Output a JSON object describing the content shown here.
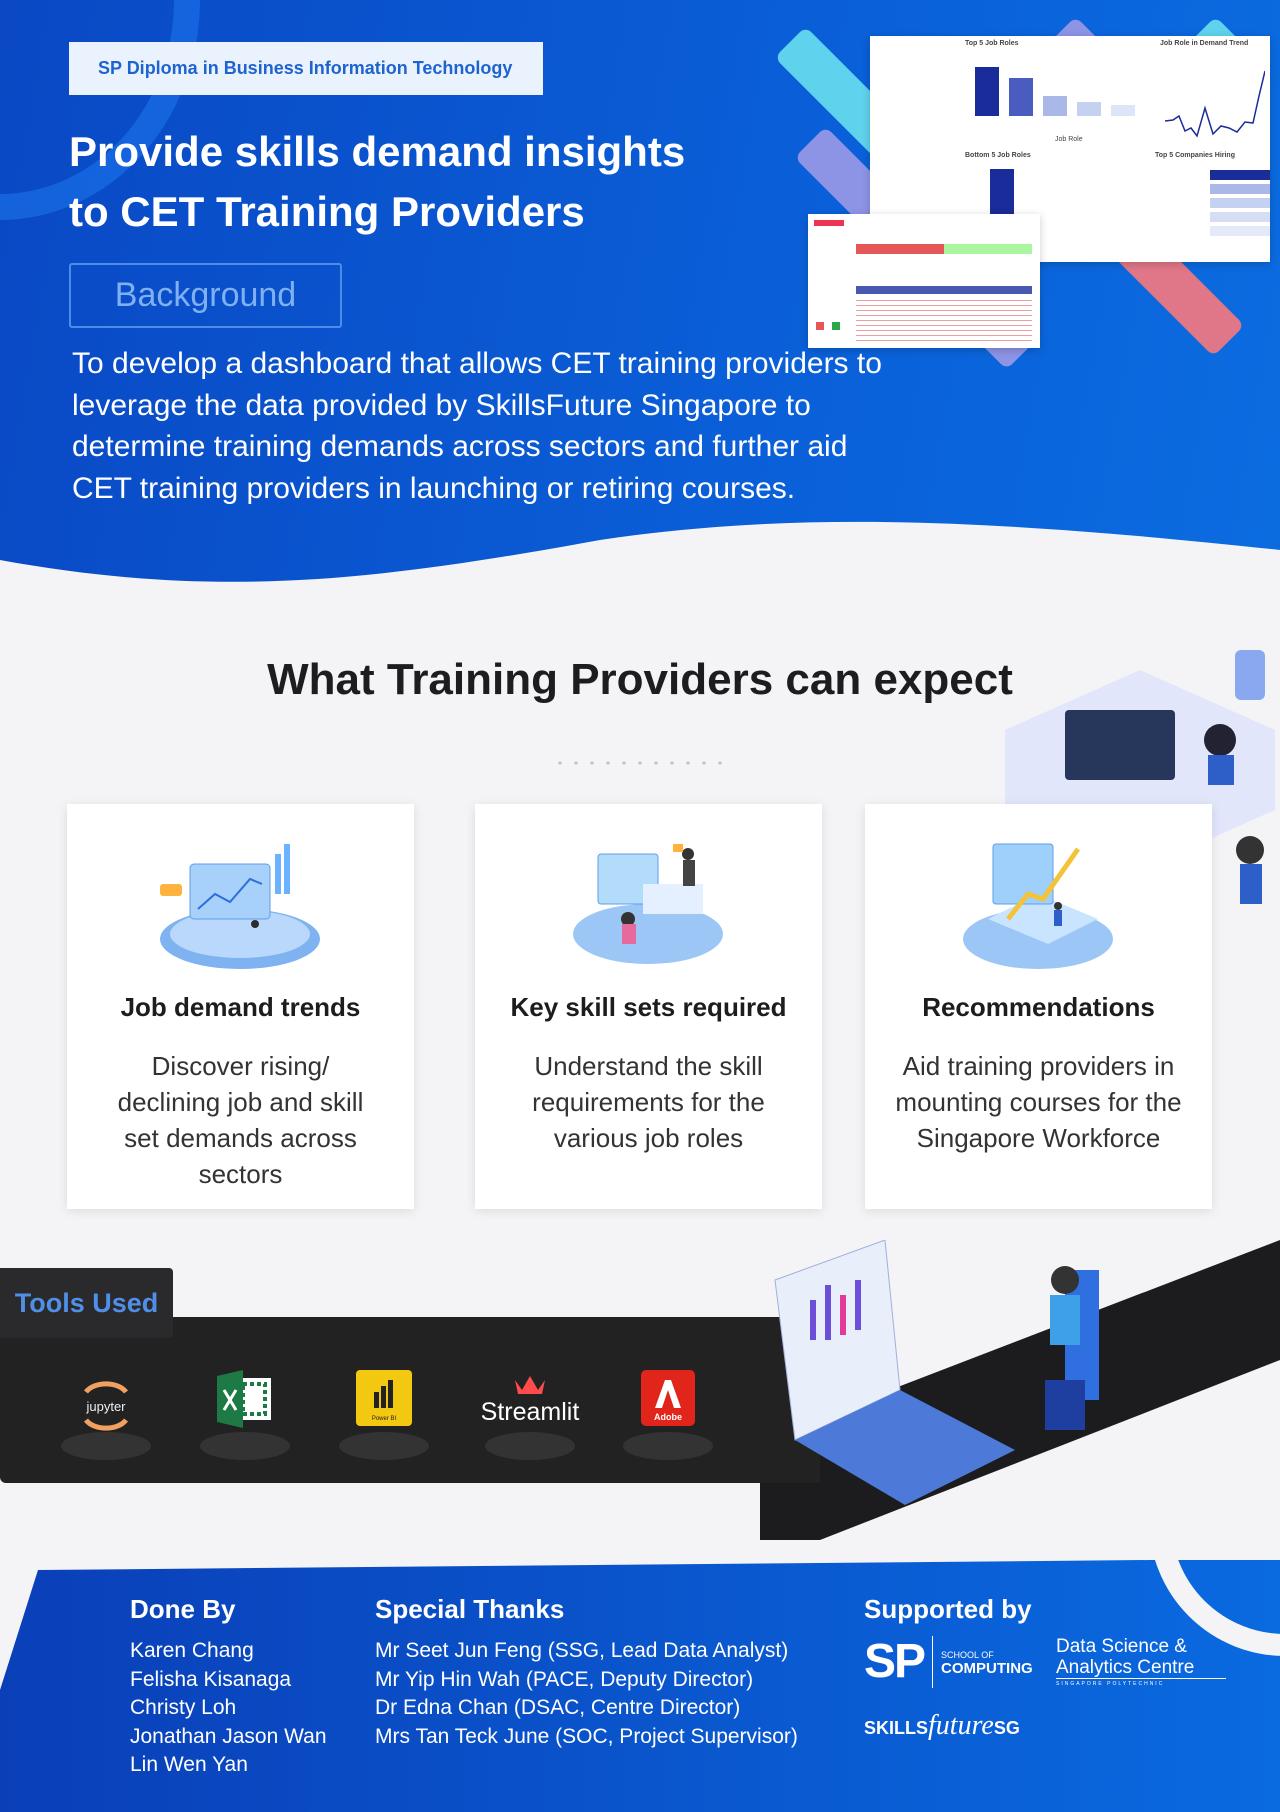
{
  "header": {
    "badge": "SP Diploma in Business Information Technology",
    "title_line1": "Provide skills demand insights",
    "title_line2": "to CET Training Providers",
    "section_label": "Background",
    "description": "To develop a dashboard that allows CET training providers to leverage the data provided by SkillsFuture Singapore to determine training demands across sectors and further aid CET training providers in launching or retiring courses."
  },
  "dashboard": {
    "chart1_title": "Top 5 Job Roles",
    "chart2_title": "Job Role in Demand Trend",
    "chart3_title": "Bottom 5 Job Roles",
    "chart4_title": "Top 5 Companies Hiring",
    "x_label": "Job Role",
    "bar_values": [
      410,
      320,
      170,
      120,
      95
    ],
    "colors": {
      "dark": "#1a2b9a",
      "mid": "#4a5cc0",
      "light": "#a9b8e6"
    }
  },
  "expect": {
    "heading": "What Training Providers can expect",
    "cards": [
      {
        "title": "Job demand trends",
        "desc": "Discover rising/ declining job and skill set demands across sectors",
        "icon": "analytics-illustration"
      },
      {
        "title": "Key skill sets required",
        "desc": "Understand the skill requirements for the various job roles",
        "icon": "workspace-illustration"
      },
      {
        "title": "Recommendations",
        "desc": "Aid training providers in mounting courses for the Singapore Workforce",
        "icon": "growth-chart-illustration"
      }
    ]
  },
  "tools": {
    "label": "Tools Used",
    "items": [
      {
        "name": "jupyter",
        "icon": "jupyter-logo"
      },
      {
        "name": "Excel",
        "icon": "excel-logo"
      },
      {
        "name": "Power BI",
        "icon": "powerbi-logo"
      },
      {
        "name": "Streamlit",
        "icon": "streamlit-logo"
      },
      {
        "name": "Adobe",
        "icon": "adobe-logo"
      }
    ]
  },
  "footer": {
    "done_by": {
      "heading": "Done By",
      "names": [
        "Karen Chang",
        "Felisha Kisanaga",
        "Christy Loh",
        "Jonathan Jason Wan",
        "Lin Wen Yan"
      ]
    },
    "thanks": {
      "heading": "Special Thanks",
      "names": [
        "Mr Seet Jun Feng (SSG, Lead Data Analyst)",
        "Mr Yip Hin Wah (PACE, Deputy Director)",
        "Dr Edna Chan (DSAC, Centre Director)",
        "Mrs Tan Teck June (SOC, Project Supervisor)"
      ]
    },
    "supported": {
      "heading": "Supported by",
      "sp": "SP",
      "soc_line1": "SCHOOL OF",
      "soc_line2": "COMPUTING",
      "dsac_line1": "Data Science &",
      "dsac_line2": "Analytics Centre",
      "dsac_sub": "SINGAPORE POLYTECHNIC",
      "skillsfuture_a": "SKILLS",
      "skillsfuture_b": "future",
      "skillsfuture_c": "SG"
    }
  },
  "colors": {
    "primary_blue": "#0a52cc",
    "dark_band": "#222222",
    "accent_light": "#eaf2fd"
  }
}
